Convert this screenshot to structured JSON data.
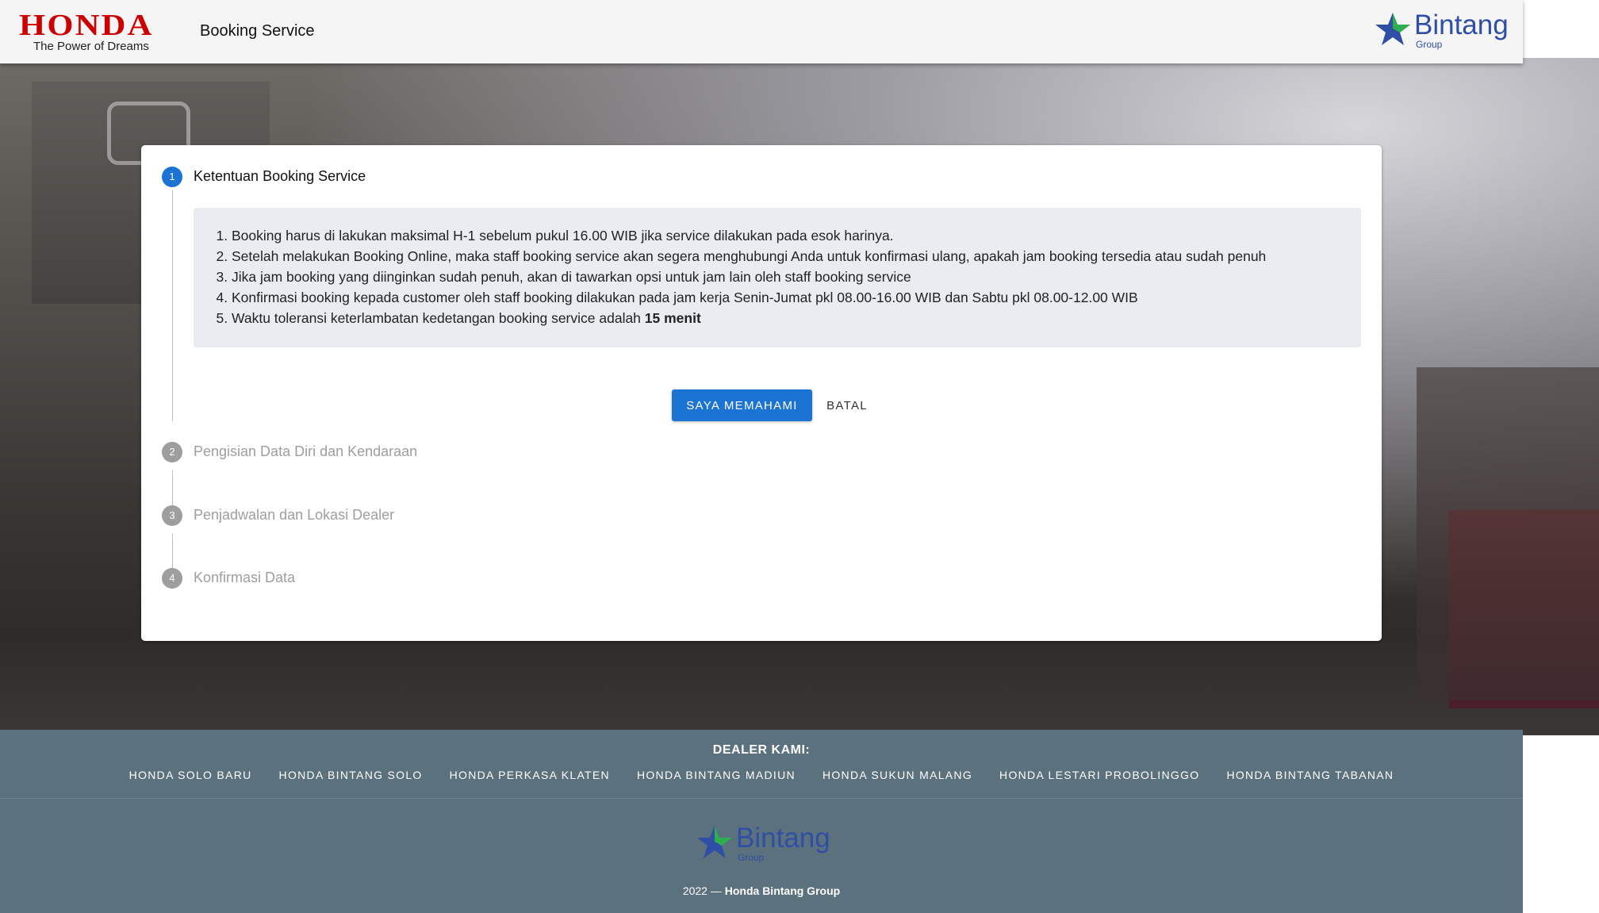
{
  "header": {
    "brand": "HONDA",
    "tagline": "The Power of Dreams",
    "app_title": "Booking Service",
    "partner_logo": "Bintang",
    "partner_sub": "Group"
  },
  "stepper": {
    "steps": [
      {
        "number": "1",
        "label": "Ketentuan Booking Service",
        "active": true
      },
      {
        "number": "2",
        "label": "Pengisian Data Diri dan Kendaraan",
        "active": false
      },
      {
        "number": "3",
        "label": "Penjadwalan dan Lokasi Dealer",
        "active": false
      },
      {
        "number": "4",
        "label": "Konfirmasi Data",
        "active": false
      }
    ],
    "terms": [
      "Booking harus di lakukan maksimal H-1 sebelum pukul 16.00 WIB jika service dilakukan pada esok harinya.",
      "Setelah melakukan Booking Online, maka staff booking service akan segera menghubungi Anda untuk konfirmasi ulang, apakah jam booking tersedia atau sudah penuh",
      "Jika jam booking yang diinginkan sudah penuh, akan di tawarkan opsi untuk jam lain oleh staff booking service",
      "Konfirmasi booking kepada customer oleh staff booking dilakukan pada jam kerja Senin-Jumat pkl 08.00-16.00 WIB dan Sabtu pkl 08.00-12.00 WIB"
    ],
    "term5_prefix": "Waktu toleransi keterlambatan kedetangan booking service adalah",
    "term5_bold": "15 menit",
    "accept_label": "SAYA MEMAHAMI",
    "cancel_label": "BATAL"
  },
  "footer": {
    "dealer_title": "DEALER KAMI:",
    "dealers": [
      "HONDA SOLO BARU",
      "HONDA BINTANG SOLO",
      "HONDA PERKASA KLATEN",
      "HONDA BINTANG MADIUN",
      "HONDA SUKUN MALANG",
      "HONDA LESTARI PROBOLINGGO",
      "HONDA BINTANG TABANAN"
    ],
    "logo": "Bintang",
    "logo_sub": "Group",
    "year": "2022 —",
    "company": "Honda Bintang Group"
  },
  "colors": {
    "primary": "#1b73d3",
    "honda_red": "#cc0000",
    "footer_bg": "#5b717d",
    "step_inactive": "#9e9e9e"
  }
}
